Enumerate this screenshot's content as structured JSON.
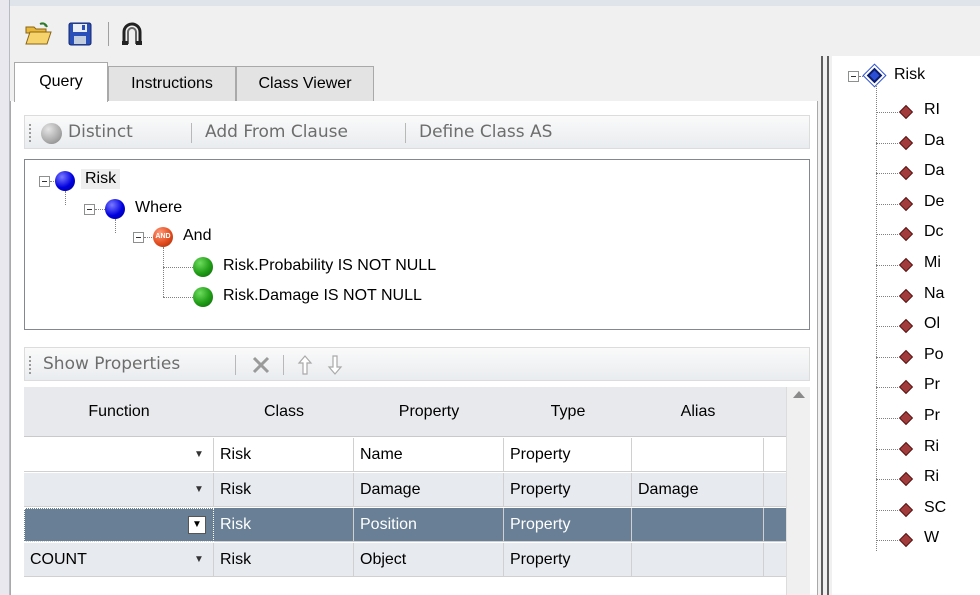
{
  "toolbar": {
    "buttons": [
      {
        "name": "open",
        "icon": "folder-open-icon"
      },
      {
        "name": "save",
        "icon": "floppy-disk-icon"
      },
      {
        "name": "run",
        "icon": "magnet-icon"
      }
    ]
  },
  "tabs": [
    {
      "label": "Query",
      "active": true
    },
    {
      "label": "Instructions",
      "active": false
    },
    {
      "label": "Class Viewer",
      "active": false
    }
  ],
  "query_toolbar": {
    "distinct": "Distinct",
    "add_from_clause": "Add From Clause",
    "define_class_as": "Define Class AS"
  },
  "query_tree": {
    "root": "Risk",
    "where": "Where",
    "and_badge": "AND",
    "and": "And",
    "conditions": [
      "Risk.Probability IS NOT NULL",
      "Risk.Damage IS NOT NULL"
    ]
  },
  "properties_toolbar": {
    "show_properties": "Show Properties",
    "icons": [
      "delete-icon",
      "move-up-icon",
      "move-down-icon"
    ]
  },
  "grid": {
    "columns": [
      "Function",
      "Class",
      "Property",
      "Type",
      "Alias"
    ],
    "rows": [
      {
        "function": "",
        "class": "Risk",
        "property": "Name",
        "type": "Property",
        "alias": ""
      },
      {
        "function": "",
        "class": "Risk",
        "property": "Damage",
        "type": "Property",
        "alias": "Damage"
      },
      {
        "function": "",
        "class": "Risk",
        "property": "Position",
        "type": "Property",
        "alias": ""
      },
      {
        "function": "COUNT",
        "class": "Risk",
        "property": "Object",
        "type": "Property",
        "alias": ""
      }
    ],
    "selected_row": 2
  },
  "class_viewer": {
    "root": "Risk",
    "items": [
      "RI",
      "Da",
      "Da",
      "De",
      "Dc",
      "Mi",
      "Na",
      "Ol",
      "Po",
      "Pr",
      "Pr",
      "Ri",
      "Ri",
      "SC",
      "W"
    ]
  },
  "colors": {
    "selection": "#687f95",
    "alt_row": "#e7eaee",
    "header": "#e7e9ec",
    "blue_node": "#0000e0",
    "green_node": "#1f9c16",
    "and_node": "#e24d1f",
    "attribute_diamond": "#a23c3c"
  }
}
